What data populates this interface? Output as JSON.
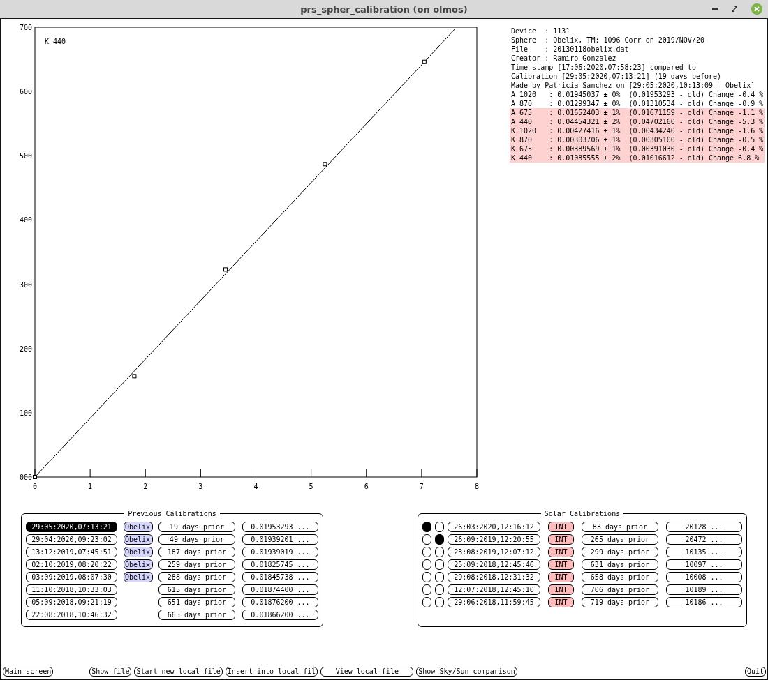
{
  "window": {
    "title": "prs_spher_calibration (on olmos)"
  },
  "chart": {
    "chart_data": {
      "type": "scatter",
      "title": "K 440",
      "x": [
        0,
        1.8,
        3.45,
        5.25,
        7.05,
        7.6
      ],
      "series": [
        {
          "values": [
            0,
            157,
            323,
            487,
            646,
            null
          ]
        },
        {
          "type": "line",
          "values": [
            0,
            165,
            316,
            481,
            646,
            697
          ]
        }
      ],
      "xlim": [
        0,
        8
      ],
      "ylim": [
        0,
        700
      ],
      "xticks": [
        0,
        1,
        2,
        3,
        4,
        5,
        6,
        7,
        8
      ],
      "yticks": [
        {
          "value": 0,
          "label": "000"
        },
        100,
        200,
        300,
        400,
        500,
        600,
        700
      ]
    }
  },
  "info": {
    "lines": [
      {
        "text": "Device  : 1131",
        "highlighted": false
      },
      {
        "text": "Sphere  : Obelix, TM: 1096 Corr on 2019/NOV/20",
        "highlighted": false
      },
      {
        "text": "File    : 20130118obelix.dat",
        "highlighted": false
      },
      {
        "text": "Creator : Ramiro Gonzalez",
        "highlighted": false
      },
      {
        "text": "Time stamp [17:06:2020,07:58:23] compared to",
        "highlighted": false
      },
      {
        "text": "Calibration [29:05:2020,07:13:21] (19 days before)",
        "highlighted": false
      },
      {
        "text": "Made by Patricia Sanchez on [29:05:2020,10:13:09 - Obelix]",
        "highlighted": false
      },
      {
        "text": "A 1020   : 0.01945037 ± 0%  (0.01953293 - old) Change -0.4 %",
        "highlighted": false
      },
      {
        "text": "A 870    : 0.01299347 ± 0%  (0.01310534 - old) Change -0.9 %",
        "highlighted": false
      },
      {
        "text": "A 675    : 0.01652403 ± 1%  (0.01671159 - old) Change -1.1 %",
        "highlighted": true
      },
      {
        "text": "A 440    : 0.04454321 ± 2%  (0.04702160 - old) Change -5.3 %",
        "highlighted": true
      },
      {
        "text": "K 1020   : 0.00427416 ± 1%  (0.00434240 - old) Change -1.6 %",
        "highlighted": true
      },
      {
        "text": "K 870    : 0.00303706 ± 1%  (0.00305100 - old) Change -0.5 %",
        "highlighted": true
      },
      {
        "text": "K 675    : 0.00389569 ± 1%  (0.00391030 - old) Change -0.4 %",
        "highlighted": true
      },
      {
        "text": "K 440    : 0.01085555 ± 2%  (0.01016612 - old) Change 6.8 %",
        "highlighted": true
      }
    ]
  },
  "previous_calibrations": {
    "title": "Previous Calibrations",
    "rows": [
      {
        "date": "29:05:2020,07:13:21",
        "selected": true,
        "station": "Obelix",
        "days": "19 days prior",
        "value": "0.01953293 ..."
      },
      {
        "date": "29:04:2020,09:23:02",
        "selected": false,
        "station": "Obelix",
        "days": "49 days prior",
        "value": "0.01939201 ..."
      },
      {
        "date": "13:12:2019,07:45:51",
        "selected": false,
        "station": "Obelix",
        "days": "187 days prior",
        "value": "0.01939019 ..."
      },
      {
        "date": "02:10:2019,08:20:22",
        "selected": false,
        "station": "Obelix",
        "days": "259 days prior",
        "value": "0.01825745 ..."
      },
      {
        "date": "03:09:2019,08:07:30",
        "selected": false,
        "station": "Obelix",
        "days": "288 days prior",
        "value": "0.01845738 ..."
      },
      {
        "date": "11:10:2018,10:33:03",
        "selected": false,
        "days": "615 days prior",
        "value": "0.01874400 ..."
      },
      {
        "date": "05:09:2018,09:21:19",
        "selected": false,
        "days": "651 days prior",
        "value": "0.01876200 ..."
      },
      {
        "date": "22:08:2018,10:46:32",
        "selected": false,
        "days": "665 days prior",
        "value": "0.01866200 ..."
      }
    ]
  },
  "solar_calibrations": {
    "title": "Solar Calibrations",
    "rows": [
      {
        "first_selected": true,
        "second_selected": false,
        "date": "26:03:2020,12:16:12",
        "type": "INT",
        "days": "83 days prior",
        "value": "20128 ..."
      },
      {
        "first_selected": false,
        "second_selected": true,
        "date": "26:09:2019,12:20:55",
        "type": "INT",
        "days": "265 days prior",
        "value": "20472 ..."
      },
      {
        "first_selected": false,
        "second_selected": false,
        "date": "23:08:2019,12:07:12",
        "type": "INT",
        "days": "299 days prior",
        "value": "10135 ..."
      },
      {
        "first_selected": false,
        "second_selected": false,
        "date": "25:09:2018,12:45:46",
        "type": "INT",
        "days": "631 days prior",
        "value": "10097 ..."
      },
      {
        "first_selected": false,
        "second_selected": false,
        "date": "29:08:2018,12:31:32",
        "type": "INT",
        "days": "658 days prior",
        "value": "10008 ..."
      },
      {
        "first_selected": false,
        "second_selected": false,
        "date": "12:07:2018,12:45:10",
        "type": "INT",
        "days": "706 days prior",
        "value": "10189 ..."
      },
      {
        "first_selected": false,
        "second_selected": false,
        "date": "29:06:2018,11:59:45",
        "type": "INT",
        "days": "719 days prior",
        "value": "10186 ..."
      }
    ]
  },
  "buttons": {
    "left": [
      "Main screen"
    ],
    "middle": [
      "Show file",
      "Start new local file",
      "Insert into local fil",
      "View local file",
      "Show Sky/Sun comparison"
    ],
    "right": [
      "Quit"
    ]
  }
}
